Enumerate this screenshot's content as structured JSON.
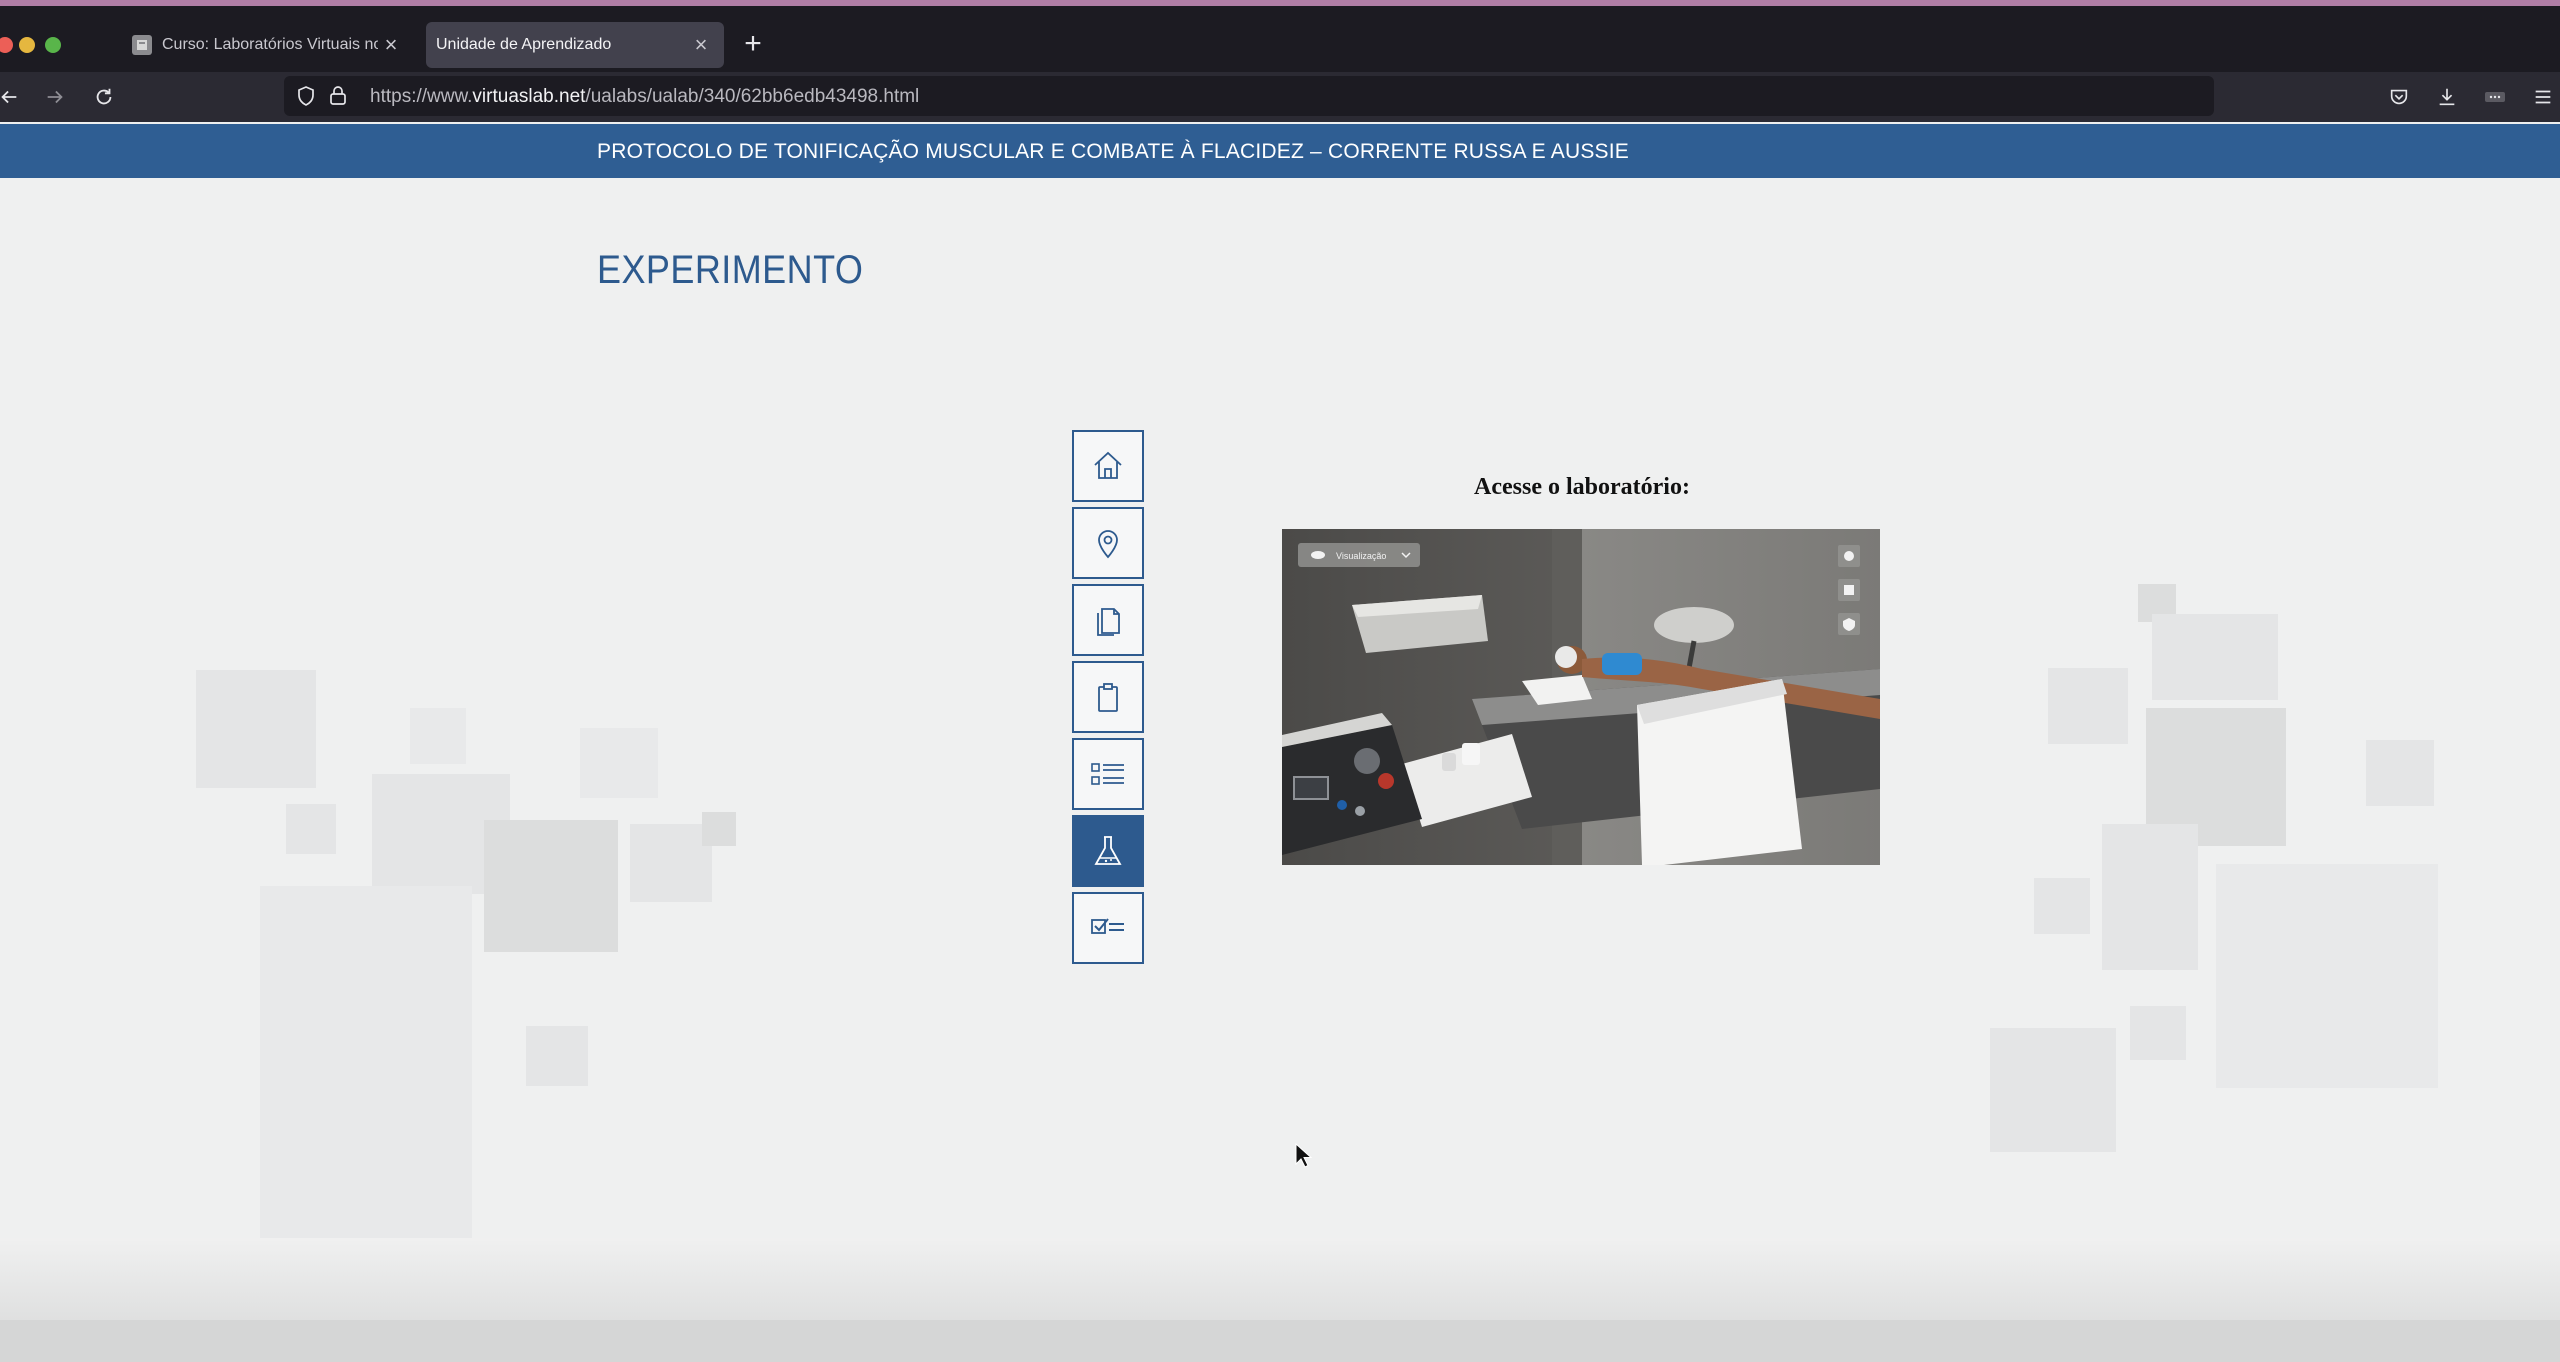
{
  "browser": {
    "tabs": [
      {
        "title": "Curso: Laboratórios Virtuais no",
        "active": false
      },
      {
        "title": "Unidade de Aprendizado",
        "active": true
      }
    ],
    "new_tab_symbol": "+",
    "close_symbol": "×",
    "url": {
      "prefix": "https://www.",
      "domain": "virtuaslab.net",
      "path": "/ualabs/ualab/340/62bb6edb43498.html"
    },
    "icons": [
      "back-arrow-icon",
      "forward-arrow-icon",
      "reload-icon",
      "shield-icon",
      "lock-icon",
      "reader-view-icon",
      "bookmark-star-icon",
      "pocket-icon",
      "download-icon",
      "extensions-icon",
      "menu-icon"
    ]
  },
  "page": {
    "banner_title": "PROTOCOLO DE TONIFICAÇÃO MUSCULAR E COMBATE À FLACIDEZ – CORRENTE RUSSA E AUSSIE",
    "section_title": "EXPERIMENTO",
    "nav_icons": [
      {
        "name": "home-icon",
        "active": false
      },
      {
        "name": "map-pin-icon",
        "active": false
      },
      {
        "name": "documents-icon",
        "active": false
      },
      {
        "name": "clipboard-icon",
        "active": false
      },
      {
        "name": "list-icon",
        "active": false
      },
      {
        "name": "flask-icon",
        "active": true
      },
      {
        "name": "checklist-icon",
        "active": false
      }
    ],
    "lab_heading": "Acesse o laboratório:",
    "lab_preview": {
      "view_label": "Visualização"
    }
  },
  "colors": {
    "brand_blue": "#2f5e93",
    "chrome_dark": "#1c1b22",
    "page_bg": "#eff0f0"
  }
}
